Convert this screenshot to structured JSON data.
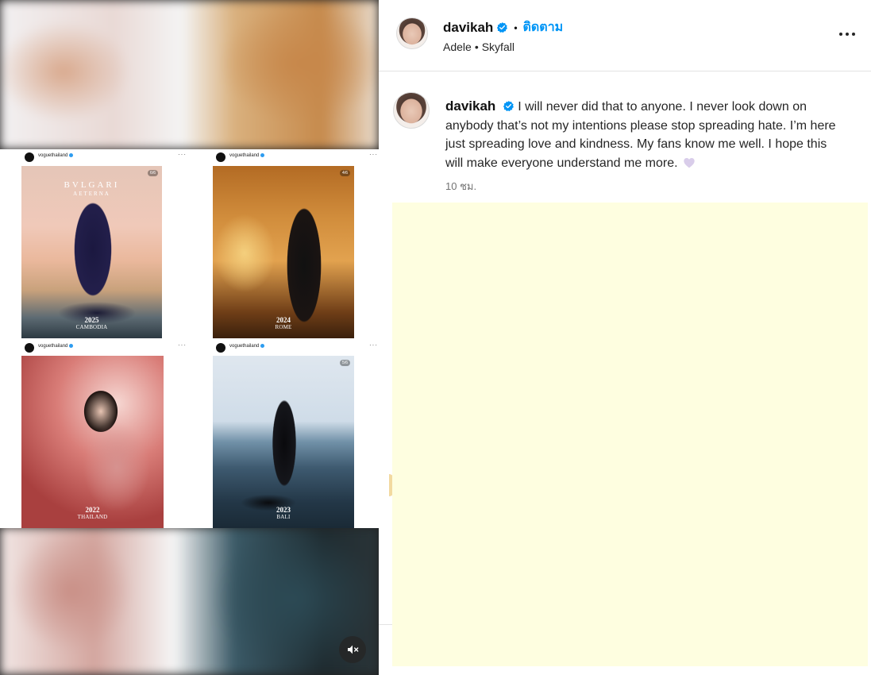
{
  "media": {
    "collage_cards": [
      {
        "account": "voguethailand",
        "count": "6/6",
        "brand": "BVLGARI",
        "brand_sub": "AETERNA",
        "year": "2025",
        "place": "CAMBODIA"
      },
      {
        "account": "voguethailand",
        "count": "4/6",
        "year": "2024",
        "place": "ROME"
      },
      {
        "account": "voguethailand",
        "count": "",
        "year": "2022",
        "place": "THAILAND"
      },
      {
        "account": "voguethailand",
        "count": "5/6",
        "year": "2023",
        "place": "BALI"
      }
    ],
    "mute_icon": "speaker-muted-icon"
  },
  "header": {
    "username": "davikah",
    "verified": true,
    "separator": "•",
    "follow_label": "ติดตาม",
    "audio": {
      "artist": "Adele",
      "separator": "•",
      "track": "Skyfall"
    },
    "more_icon": "more-options-icon"
  },
  "caption": {
    "username": "davikah",
    "text": "I will never did that to anyone. I never look down on anybody that’s not my intentions please stop spreading hate. I’m here just spreading love and kindness. My fans know me well. I hope this will make everyone understand me more.",
    "emoji_icon": "purple-heart-icon",
    "timestamp": "10 ชม."
  },
  "colors": {
    "verified_blue": "#0095f6",
    "follow_blue": "#0095f6",
    "overlay_yellow": "#fefee0",
    "muted_text": "#737373"
  }
}
